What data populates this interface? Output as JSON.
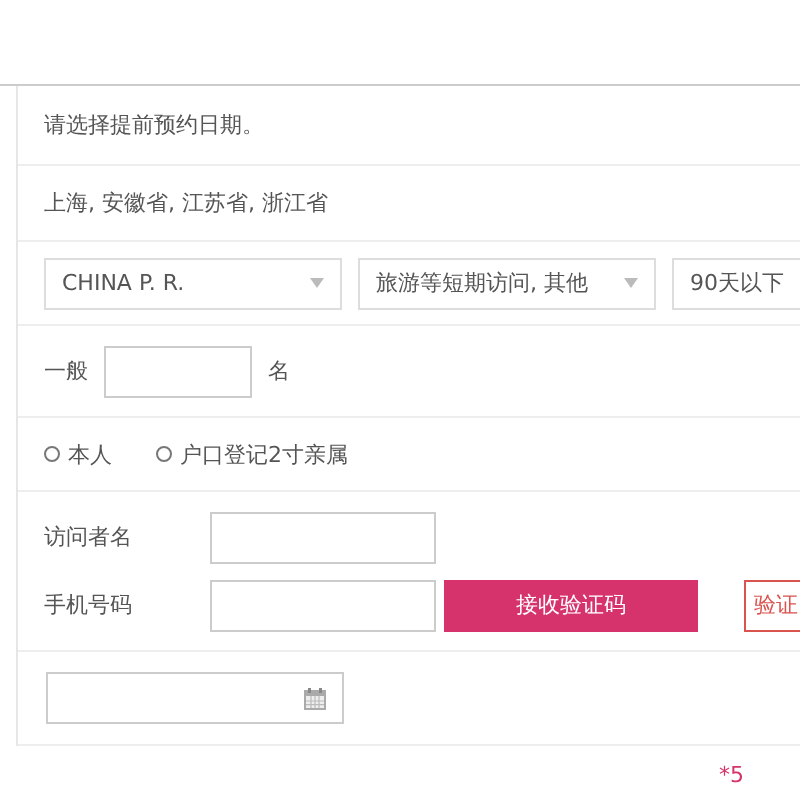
{
  "notice": "请选择提前预约日期。",
  "regions": "上海, 安徽省, 江苏省, 浙江省",
  "selects": [
    {
      "value": "CHINA P. R."
    },
    {
      "value": "旅游等短期访问, 其他"
    },
    {
      "value": "90天以下"
    }
  ],
  "count": {
    "label": "一般",
    "unit": "名"
  },
  "relation": [
    {
      "label": "本人",
      "selected": false
    },
    {
      "label": "户口登记2寸亲属",
      "selected": false
    }
  ],
  "visitor_label": "访问者名",
  "phone_label": "手机号码",
  "receive_code_button": "接收验证码",
  "code_field": "验证",
  "footnote": "*5"
}
